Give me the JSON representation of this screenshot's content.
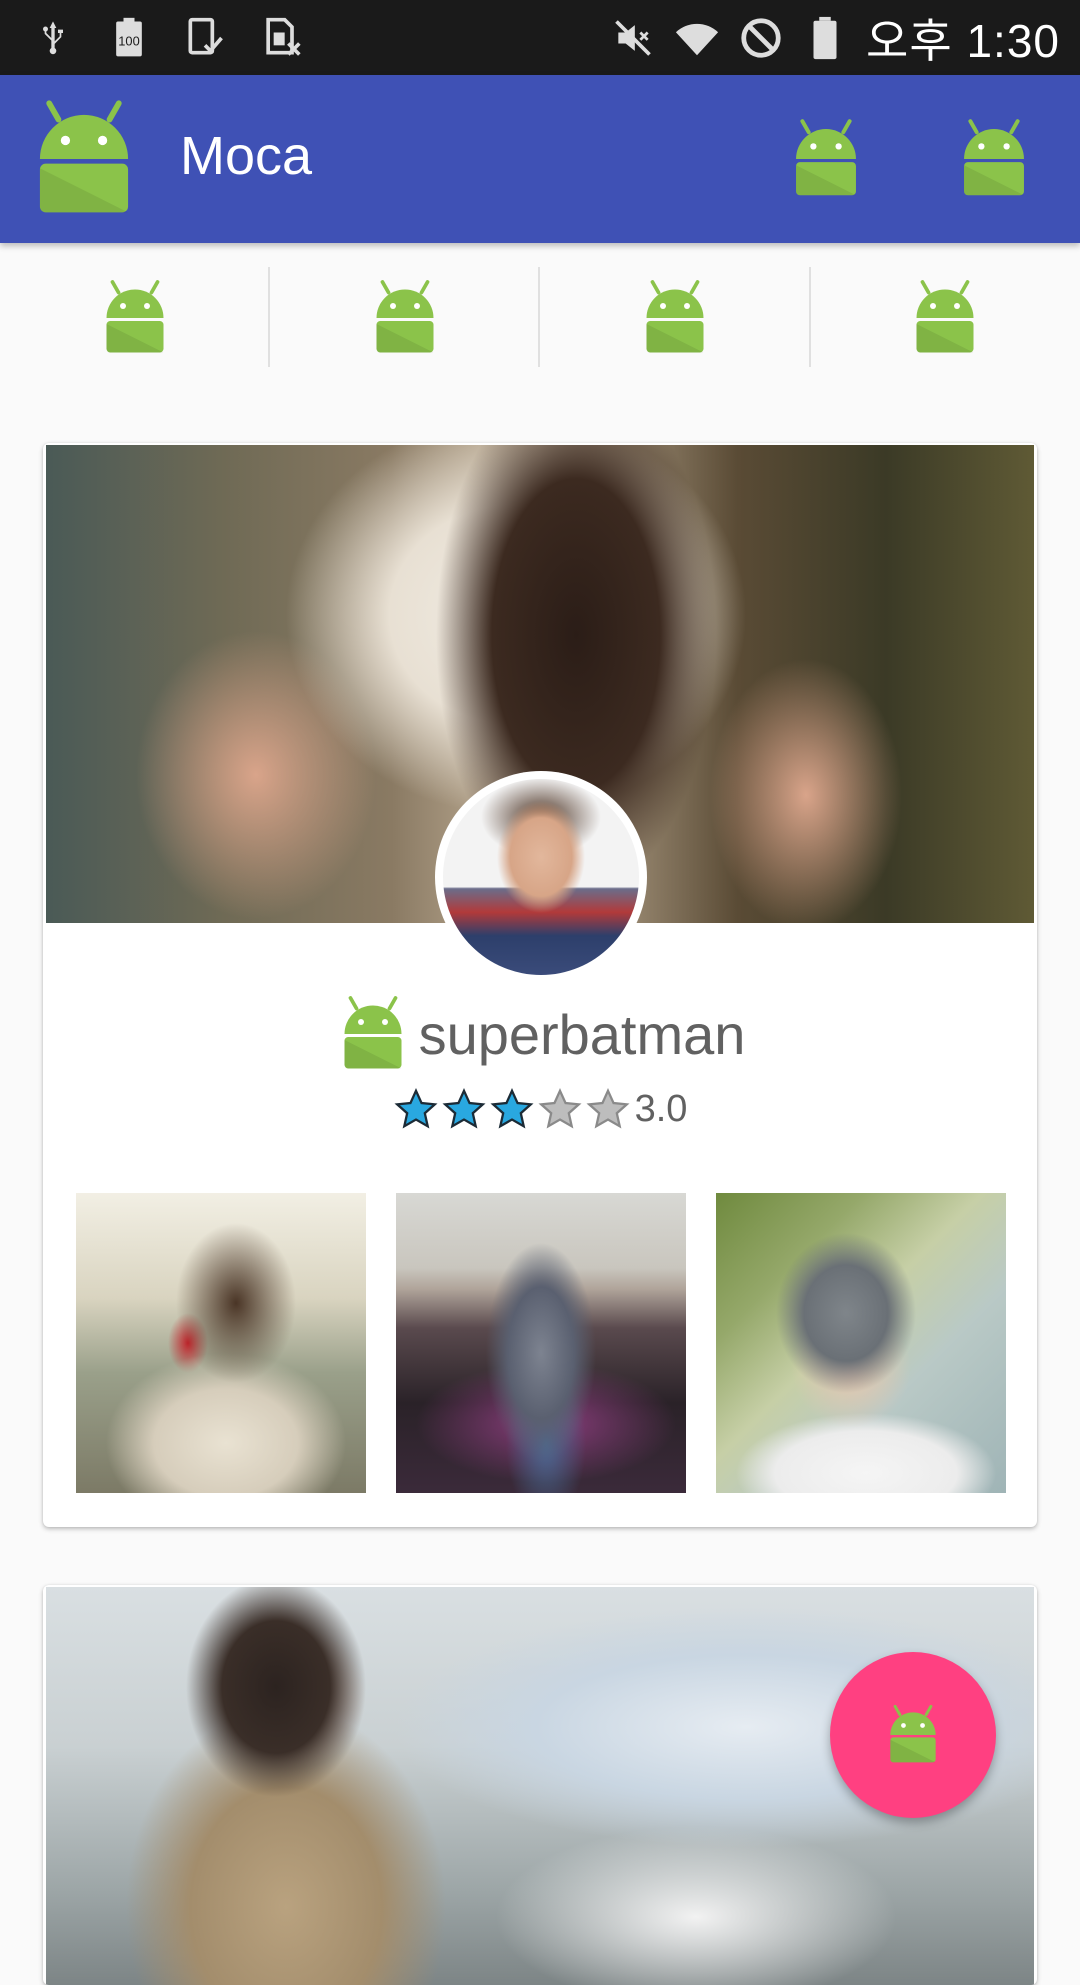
{
  "status_bar": {
    "left_icons": [
      "usb-icon",
      "battery-100-icon",
      "screenshot-icon",
      "sim-off-icon"
    ],
    "right_icons": [
      "mute-icon",
      "wifi-icon",
      "do-not-disturb-icon",
      "battery-icon"
    ],
    "battery_badge": "100",
    "time": "오후 1:30"
  },
  "appbar": {
    "title": "Moca",
    "logo_icon": "android-icon",
    "actions": [
      "android-icon",
      "android-icon"
    ]
  },
  "tabs": [
    {
      "icon": "android-icon"
    },
    {
      "icon": "android-icon"
    },
    {
      "icon": "android-icon"
    },
    {
      "icon": "android-icon"
    }
  ],
  "profile_card": {
    "username": "superbatman",
    "rating_value": "3.0",
    "rating": 3,
    "rating_max": 5,
    "star_filled_color": "#29a8e0",
    "star_empty_color": "#9e9e9e",
    "photos": [
      "photo-1",
      "photo-2",
      "photo-3"
    ]
  },
  "fab": {
    "icon": "android-icon",
    "color": "#ff4081"
  },
  "colors": {
    "appbar": "#3f51b5",
    "status_bar": "#1a1a1a",
    "android_green": "#8bc34a"
  }
}
